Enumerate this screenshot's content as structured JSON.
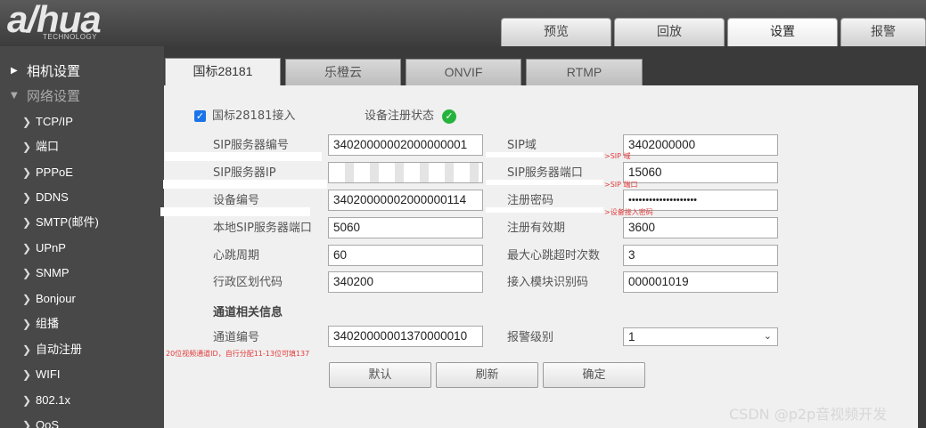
{
  "logo": {
    "name": "a/hua",
    "sub": "TECHNOLOGY"
  },
  "top_tabs": [
    "预览",
    "回放",
    "设置",
    "报警"
  ],
  "sidebar": {
    "groups": [
      "相机设置",
      "网络设置"
    ],
    "items": [
      "TCP/IP",
      "端口",
      "PPPoE",
      "DDNS",
      "SMTP(邮件)",
      "UPnP",
      "SNMP",
      "Bonjour",
      "组播",
      "自动注册",
      "WIFI",
      "802.1x",
      "QoS"
    ]
  },
  "sub_tabs": [
    "国标28181",
    "乐橙云",
    "ONVIF",
    "RTMP"
  ],
  "form": {
    "enable_label": "国标28181接入",
    "status_label": "设备注册状态",
    "sip_server_id_label": "SIP服务器编号",
    "sip_server_id_value": "34020000002000000001",
    "sip_domain_label": "SIP域",
    "sip_domain_value": "3402000000",
    "sip_server_ip_label": "SIP服务器IP",
    "sip_server_port_label": "SIP服务器端口",
    "sip_server_port_value": "15060",
    "device_id_label": "设备编号",
    "device_id_value": "34020000002000000114",
    "reg_password_label": "注册密码",
    "reg_password_value": "••••••••••••••••••••",
    "local_port_label": "本地SIP服务器端口",
    "local_port_value": "5060",
    "reg_valid_label": "注册有效期",
    "reg_valid_value": "3600",
    "heartbeat_label": "心跳周期",
    "heartbeat_value": "60",
    "max_timeout_label": "最大心跳超时次数",
    "max_timeout_value": "3",
    "region_label": "行政区划代码",
    "region_value": "340200",
    "module_id_label": "接入模块识别码",
    "module_id_value": "000001019",
    "channel_section": "通道相关信息",
    "channel_id_label": "通道编号",
    "channel_id_value": "34020000001370000010",
    "alarm_level_label": "报警级别",
    "alarm_level_value": "1"
  },
  "annotations": {
    "sip_domain": ">SIP 域",
    "sip_port": ">SIP 端口",
    "device_password": ">设备接入密码",
    "channel_note": "20位视频通道ID，自行分配11-13位可填137"
  },
  "buttons": {
    "default": "默认",
    "refresh": "刷新",
    "confirm": "确定"
  },
  "watermark": "CSDN @p2p音视频开发",
  "colors": {
    "check": "#1a73e8",
    "status_ok": "#26b33d",
    "annotation": "#e23b3b"
  }
}
